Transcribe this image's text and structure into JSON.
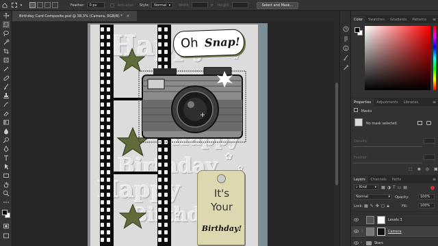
{
  "options_bar": {
    "feather_label": "Feather:",
    "feather_value": "0 px",
    "antialias_label": "Anti-alias",
    "style_label": "Style:",
    "style_value": "Normal",
    "width_label": "Width:",
    "height_label": "Height:",
    "select_mask_label": "Select and Mask..."
  },
  "document": {
    "tab_title": "Birthday Card Composite.psd @ 38.3% (Camera, RGB/8) *"
  },
  "artwork": {
    "embossed_words": [
      "Happy",
      "Birthday",
      "Happy",
      "Birthday",
      "Happy"
    ],
    "bubble_oh": "Oh",
    "bubble_snap": "Snap!",
    "tag_line1": "It's",
    "tag_line2": "Your",
    "tag_line3": "Birthday!",
    "star_color": "#5f6b3a",
    "tag_color": "#ddd8b0"
  },
  "color_panel": {
    "tabs": [
      "Color",
      "Swatches",
      "Gradients",
      "Patterns"
    ],
    "active_tab": "Color",
    "hue_color": "#ff0000"
  },
  "properties_panel": {
    "tabs": [
      "Properties",
      "Adjustments",
      "Libraries"
    ],
    "active_tab": "Properties",
    "section_label": "Masks",
    "mask_status": "No mask selected",
    "density_label": "Density:",
    "feather_label": "Feather:"
  },
  "layers_panel": {
    "tabs": [
      "Layers",
      "Channels",
      "Paths"
    ],
    "active_tab": "Layers",
    "kind_filter": "Kind",
    "blend_mode": "Normal",
    "opacity_label": "Opacity:",
    "opacity_value": "100%",
    "lock_label": "Lock:",
    "fill_label": "Fill:",
    "fill_value": "100%",
    "layers": [
      {
        "name": "Levels 3",
        "selected": false
      },
      {
        "name": "Camera",
        "selected": true
      },
      {
        "name": "Stars",
        "selected": false
      }
    ]
  },
  "icons": {
    "toolbar": [
      "move-icon",
      "marquee-icon",
      "lasso-icon",
      "quick-select-icon",
      "crop-icon",
      "frame-icon",
      "eyedropper-icon",
      "healing-icon",
      "brush-icon",
      "stamp-icon",
      "history-brush-icon",
      "eraser-icon",
      "gradient-icon",
      "blur-icon",
      "dodge-icon",
      "pen-icon",
      "type-icon",
      "path-select-icon",
      "rectangle-icon",
      "hand-icon",
      "zoom-icon",
      "more-tools-icon"
    ],
    "strip": [
      "history-icon",
      "paragraph-icon",
      "info-icon",
      "brushes-icon",
      "tool-presets-icon"
    ]
  }
}
